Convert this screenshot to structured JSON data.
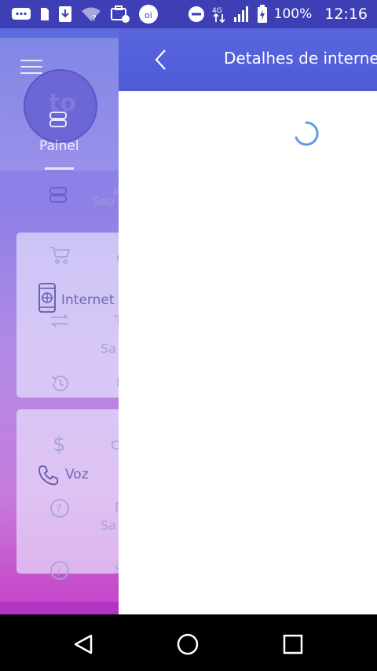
{
  "status_bar": {
    "battery_percent": "100%",
    "time": "12:16",
    "network_type": "4G",
    "icons": [
      "chat-icon",
      "sd-card-icon",
      "download-icon",
      "wifi-icon",
      "briefcase-icon",
      "oi-app-icon",
      "dnd-icon",
      "signal-icon",
      "battery-icon"
    ]
  },
  "background_app": {
    "avatar_initials": "to",
    "nav_label": "Painel",
    "seu_text": "Seu",
    "p_text": "P",
    "cards": [
      {
        "label": "Internet",
        "icons": [
          "cart-icon",
          "phone-web-icon",
          "swap-icon",
          "history-icon"
        ],
        "ghost_texts": [
          "C",
          "T",
          "Sa",
          "I"
        ]
      },
      {
        "label": "Voz",
        "icons": [
          "dollar-icon",
          "call-icon",
          "help-icon",
          "info-icon"
        ],
        "ghost_texts": [
          "C",
          "D",
          "Sa",
          "S"
        ]
      }
    ]
  },
  "detail_panel": {
    "title": "Detalhes de internet",
    "loading": true
  },
  "nav_bar": {
    "buttons": [
      "back",
      "home",
      "recent"
    ]
  },
  "colors": {
    "status_bar": "#3F3FB5",
    "header": "#5362DA",
    "gradient_top": "#7A86E6",
    "gradient_bottom": "#C63FC6",
    "spinner": "#5B9BE8"
  }
}
